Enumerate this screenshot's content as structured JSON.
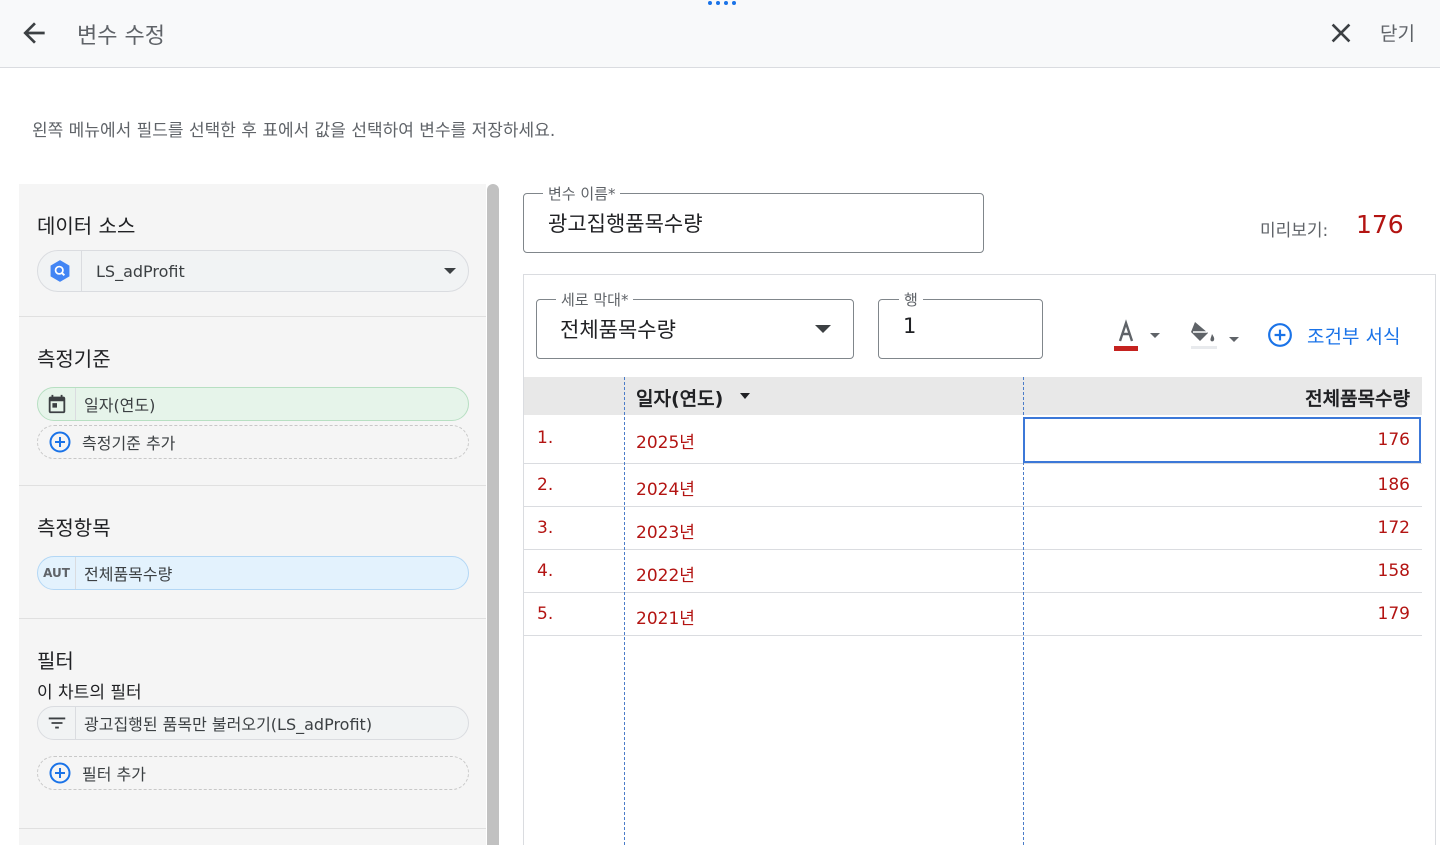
{
  "header": {
    "title": "변수 수정",
    "close_label": "닫기"
  },
  "instruction": "왼쪽 메뉴에서 필드를 선택한 후 표에서 값을 선택하여 변수를 저장하세요.",
  "left_panel": {
    "data_source": {
      "title": "데이터 소스",
      "value": "LS_adProfit",
      "icon": "bigquery-icon"
    },
    "dimension": {
      "title": "측정기준",
      "chip": "일자(연도)",
      "chip_icon": "calendar-icon",
      "add_label": "측정기준 추가"
    },
    "metric": {
      "title": "측정항목",
      "chip_prefix": "AUT",
      "chip": "전체품목수량",
      "add_label": ""
    },
    "filter": {
      "title": "필터",
      "subtitle": "이 차트의 필터",
      "chip": "광고집행된 품목만 불러오기(LS_adProfit)",
      "chip_icon": "filter-icon",
      "add_label": "필터 추가"
    }
  },
  "variable": {
    "name_label": "변수 이름*",
    "name_value": "광고집행품목수량",
    "preview_label": "미리보기:",
    "preview_value": "176"
  },
  "controls": {
    "column_label": "세로 막대*",
    "column_value": "전체품목수량",
    "row_label": "행",
    "row_value": "1",
    "text_color_icon": "text-color-icon",
    "fill_color_icon": "fill-color-icon",
    "text_color": "#c5221f",
    "conditional_label": "조건부 서식"
  },
  "table": {
    "headers": {
      "index": "",
      "date": "일자(연도)",
      "value": "전체품목수량"
    },
    "rows": [
      {
        "index": "1.",
        "date": "2025년",
        "value": "176"
      },
      {
        "index": "2.",
        "date": "2024년",
        "value": "186"
      },
      {
        "index": "3.",
        "date": "2023년",
        "value": "172"
      },
      {
        "index": "4.",
        "date": "2022년",
        "value": "158"
      },
      {
        "index": "5.",
        "date": "2021년",
        "value": "179"
      }
    ]
  },
  "colors": {
    "accent": "#1a73e8",
    "value_red": "#b31412"
  }
}
